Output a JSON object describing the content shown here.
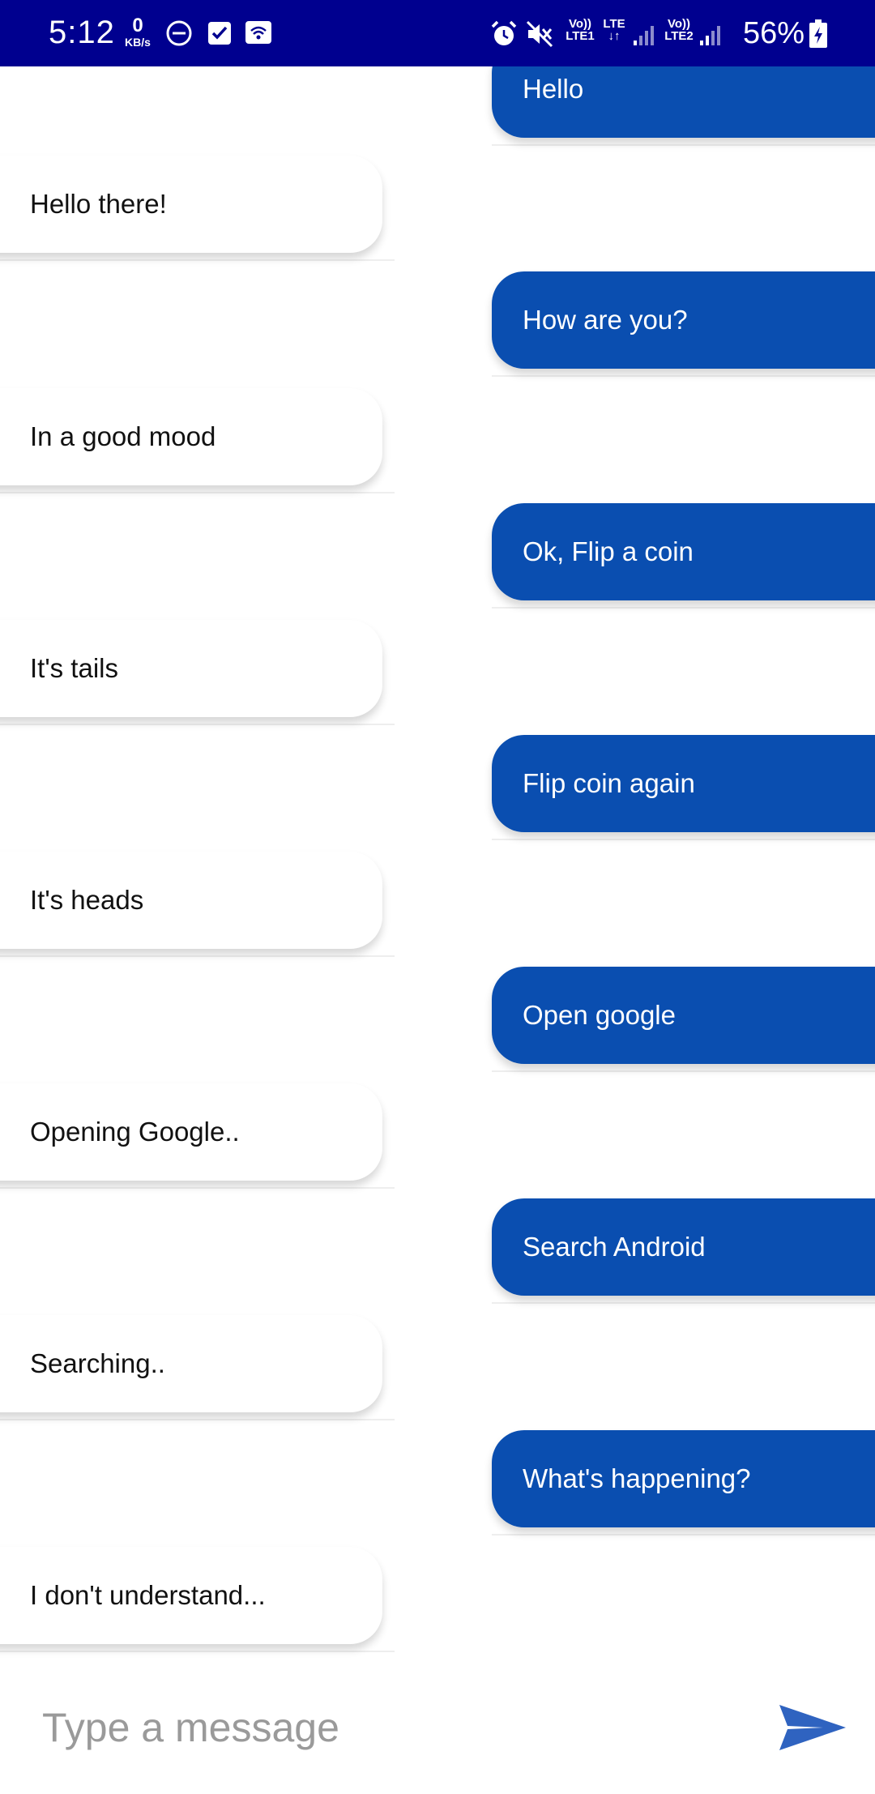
{
  "status_bar": {
    "time": "5:12",
    "speed_value": "0",
    "speed_unit": "KB/s",
    "sim1_label_top": "Vo))",
    "sim1_label_bottom": "LTE1",
    "lte_label": "LTE",
    "sim2_label_top": "Vo))",
    "sim2_label_bottom": "LTE2",
    "battery_percent": "56%",
    "icons": [
      "dnd-icon",
      "checkbox-icon",
      "wifi-calling-icon",
      "alarm-icon",
      "mute-icon",
      "signal-icon",
      "battery-charging-icon"
    ]
  },
  "messages": [
    {
      "sender": "user",
      "text": "Hello"
    },
    {
      "sender": "bot",
      "text": "Hello there!"
    },
    {
      "sender": "user",
      "text": "How are you?"
    },
    {
      "sender": "bot",
      "text": "In a good mood"
    },
    {
      "sender": "user",
      "text": "Ok, Flip a coin"
    },
    {
      "sender": "bot",
      "text": "It's tails"
    },
    {
      "sender": "user",
      "text": "Flip coin again"
    },
    {
      "sender": "bot",
      "text": "It's heads"
    },
    {
      "sender": "user",
      "text": "Open google"
    },
    {
      "sender": "bot",
      "text": "Opening Google.."
    },
    {
      "sender": "user",
      "text": "Search Android"
    },
    {
      "sender": "bot",
      "text": "Searching.."
    },
    {
      "sender": "user",
      "text": "What's happening?"
    },
    {
      "sender": "bot",
      "text": "I don't understand..."
    }
  ],
  "composer": {
    "placeholder": "Type a message",
    "value": ""
  },
  "colors": {
    "status_bar": "#00008f",
    "user_bubble": "#0a4eb0",
    "bot_bubble": "#ffffff",
    "send_icon": "#2f63c0"
  }
}
